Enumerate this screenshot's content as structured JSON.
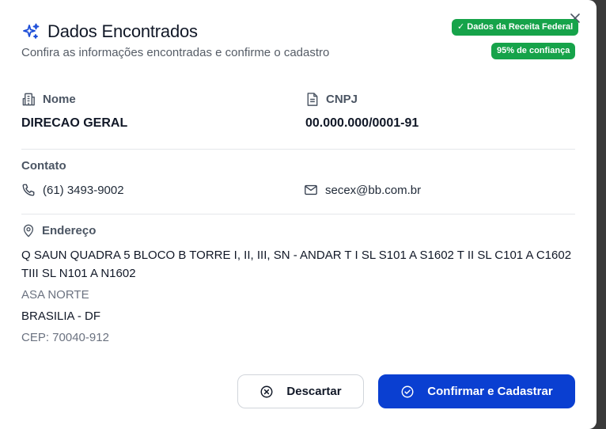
{
  "header": {
    "title": "Dados Encontrados",
    "subtitle": "Confira as informações encontradas e confirme o cadastro",
    "badge_source": "✓ Dados da Receita Federal",
    "badge_confidence": "95% de confiança",
    "close_symbol": "×"
  },
  "fields": {
    "nome_label": "Nome",
    "nome_value": "DIRECAO GERAL",
    "cnpj_label": "CNPJ",
    "cnpj_value": "00.000.000/0001-91"
  },
  "contato": {
    "label": "Contato",
    "phone": "(61) 3493-9002",
    "email": "secex@bb.com.br"
  },
  "endereco": {
    "label": "Endereço",
    "logradouro": "Q SAUN QUADRA 5 BLOCO B TORRE I, II, III, SN - ANDAR T I SL S101 A S1602 T II SL C101 A C1602 TIII SL N101 A N1602",
    "bairro": "ASA NORTE",
    "cidade_uf": "BRASILIA - DF",
    "cep": "CEP: 70040-912"
  },
  "buttons": {
    "discard": "Descartar",
    "confirm": "Confirmar e Cadastrar"
  },
  "colors": {
    "accent": "#0a3fd1",
    "success": "#16a34a",
    "sparkle": "#1d4ed8"
  },
  "icons": {
    "title": "sparkles-icon",
    "nome": "building-icon",
    "cnpj": "document-icon",
    "phone": "phone-icon",
    "email": "mail-icon",
    "endereco": "map-pin-icon",
    "discard": "x-circle-icon",
    "confirm": "check-circle-icon",
    "close": "close-icon"
  }
}
